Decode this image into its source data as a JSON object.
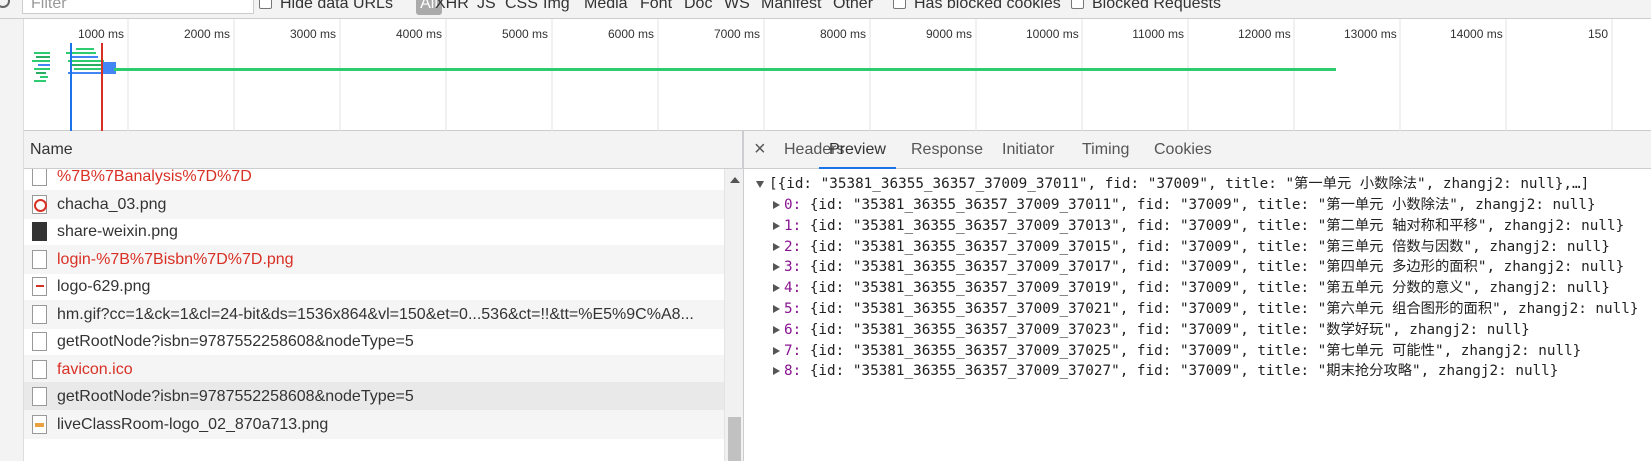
{
  "filter_bar": {
    "filter_placeholder": "Filter",
    "hide_data_urls": "Hide data URLs",
    "all": "All",
    "types": [
      "XHR",
      "JS",
      "CSS",
      "Img",
      "Media",
      "Font",
      "Doc",
      "WS",
      "Manifest",
      "Other"
    ],
    "has_blocked_cookies": "Has blocked cookies",
    "blocked_requests": "Blocked Requests"
  },
  "timeline": {
    "ticks": [
      "1000 ms",
      "2000 ms",
      "3000 ms",
      "4000 ms",
      "5000 ms",
      "6000 ms",
      "7000 ms",
      "8000 ms",
      "9000 ms",
      "10000 ms",
      "11000 ms",
      "12000 ms",
      "13000 ms",
      "14000 ms",
      "150"
    ],
    "colors": {
      "bar_green": "#2ecc71",
      "bar_blue": "#4285f4",
      "dom_line": "#1a73e8",
      "load_line": "#d93025"
    }
  },
  "requests": {
    "header": "Name",
    "rows": [
      {
        "name": "%7B%7Banalysis%7D%7D",
        "error": true,
        "icon": "file-icon"
      },
      {
        "name": "chacha_03.png",
        "error": false,
        "icon": "error-image-icon"
      },
      {
        "name": "share-weixin.png",
        "error": false,
        "icon": "dark-image-icon"
      },
      {
        "name": "login-%7B%7Bisbn%7D%7D.png",
        "error": true,
        "icon": "file-icon"
      },
      {
        "name": "logo-629.png",
        "error": false,
        "icon": "image-icon"
      },
      {
        "name": "hm.gif?cc=1&ck=1&cl=24-bit&ds=1536x864&vl=150&et=0...536&ct=!!&tt=%E5%9C%A8...",
        "error": false,
        "icon": "file-icon"
      },
      {
        "name": "getRootNode?isbn=9787552258608&nodeType=5",
        "error": false,
        "icon": "file-icon"
      },
      {
        "name": "favicon.ico",
        "error": true,
        "icon": "file-icon"
      },
      {
        "name": "getRootNode?isbn=9787552258608&nodeType=5",
        "error": false,
        "icon": "file-icon",
        "selected": true
      },
      {
        "name": "liveClassRoom-logo_02_870a713.png",
        "error": false,
        "icon": "logo-image-icon"
      }
    ]
  },
  "details": {
    "close": "×",
    "tabs": [
      "Headers",
      "Preview",
      "Response",
      "Initiator",
      "Timing",
      "Cookies"
    ],
    "active_tab": "Preview",
    "summary": "[{id: \"35381_36355_36357_37009_37011\", fid: \"37009\", title: \"第一单元 小数除法\", zhangj2: null},…]",
    "items": [
      {
        "index": "0:",
        "text": " {id: \"35381_36355_36357_37009_37011\", fid: \"37009\", title: \"第一单元 小数除法\", zhangj2: null}"
      },
      {
        "index": "1:",
        "text": " {id: \"35381_36355_36357_37009_37013\", fid: \"37009\", title: \"第二单元 轴对称和平移\", zhangj2: null}"
      },
      {
        "index": "2:",
        "text": " {id: \"35381_36355_36357_37009_37015\", fid: \"37009\", title: \"第三单元 倍数与因数\", zhangj2: null}"
      },
      {
        "index": "3:",
        "text": " {id: \"35381_36355_36357_37009_37017\", fid: \"37009\", title: \"第四单元 多边形的面积\", zhangj2: null}"
      },
      {
        "index": "4:",
        "text": " {id: \"35381_36355_36357_37009_37019\", fid: \"37009\", title: \"第五单元 分数的意义\", zhangj2: null}"
      },
      {
        "index": "5:",
        "text": " {id: \"35381_36355_36357_37009_37021\", fid: \"37009\", title: \"第六单元 组合图形的面积\", zhangj2: null}"
      },
      {
        "index": "6:",
        "text": " {id: \"35381_36355_36357_37009_37023\", fid: \"37009\", title: \"数学好玩\", zhangj2: null}"
      },
      {
        "index": "7:",
        "text": " {id: \"35381_36355_36357_37009_37025\", fid: \"37009\", title: \"第七单元 可能性\", zhangj2: null}"
      },
      {
        "index": "8:",
        "text": " {id: \"35381_36355_36357_37009_37027\", fid: \"37009\", title: \"期末抢分攻略\", zhangj2: null}"
      }
    ]
  }
}
